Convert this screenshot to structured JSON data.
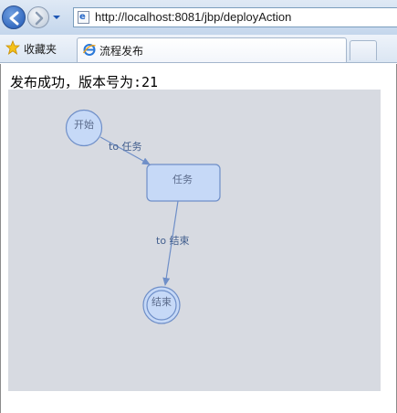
{
  "browser": {
    "url": "http://localhost:8081/jbp/deployAction",
    "favorites_label": "收藏夹",
    "tab_title": "流程发布"
  },
  "page": {
    "message": "发布成功，版本号为:21"
  },
  "process": {
    "start_node": "开始",
    "task_node": "任务",
    "end_node": "结束",
    "transition_1": "to 任务",
    "transition_2": "to 结束"
  },
  "colors": {
    "node_fill": "#c6d9f7",
    "node_stroke": "#6f8fc8",
    "diagram_bg": "#d7dae1"
  }
}
